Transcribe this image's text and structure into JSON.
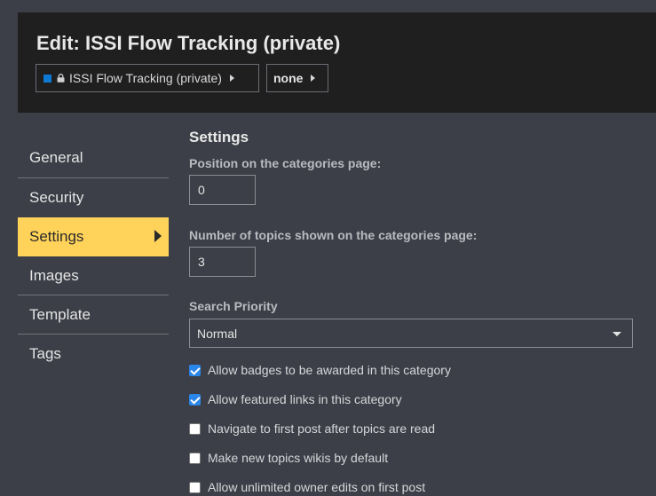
{
  "header": {
    "title": "Edit: ISSI Flow Tracking (private)",
    "category_breadcrumb": "ISSI Flow Tracking (private)",
    "subcategory_breadcrumb": "none",
    "category_color": "#0e79d4"
  },
  "sidebar": {
    "items": [
      {
        "label": "General",
        "active": false
      },
      {
        "label": "Security",
        "active": false
      },
      {
        "label": "Settings",
        "active": true
      },
      {
        "label": "Images",
        "active": false
      },
      {
        "label": "Template",
        "active": false
      },
      {
        "label": "Tags",
        "active": false
      }
    ],
    "active_color": "#ffd25a"
  },
  "settings": {
    "title": "Settings",
    "position_label": "Position on the categories page:",
    "position_value": "0",
    "num_topics_label": "Number of topics shown on the categories page:",
    "num_topics_value": "3",
    "search_priority_label": "Search Priority",
    "search_priority_value": "Normal",
    "checkboxes": [
      {
        "label": "Allow badges to be awarded in this category",
        "checked": true
      },
      {
        "label": "Allow featured links in this category",
        "checked": true
      },
      {
        "label": "Navigate to first post after topics are read",
        "checked": false
      },
      {
        "label": "Make new topics wikis by default",
        "checked": false
      },
      {
        "label": "Allow unlimited owner edits on first post",
        "checked": false
      }
    ]
  }
}
